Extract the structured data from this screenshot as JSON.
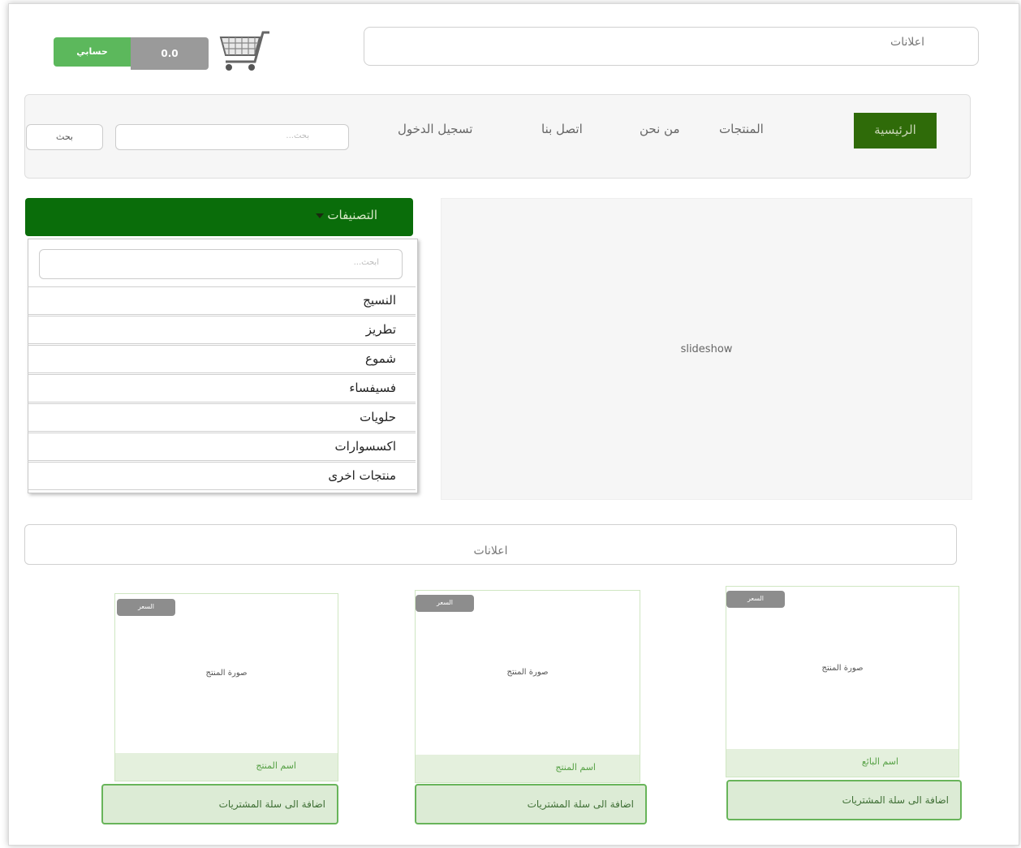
{
  "header": {
    "ads_label": "اعلانات",
    "account_button": "حسابي",
    "cart_balance": "0.0",
    "cart_icon": "shopping-cart-icon"
  },
  "nav": {
    "items": [
      "الرئيسية",
      "المنتجات",
      "من نحن",
      "اتصل بنا",
      "تسجيل الدخول"
    ],
    "active": "الرئيسية",
    "search_placeholder": "بحث...",
    "search_button": "بحث",
    "active_color": "#2f6b09"
  },
  "categories": {
    "title": "التصنيفات",
    "search_placeholder": "ابحث...",
    "items": [
      "النسيج",
      "تطريز",
      "شموع",
      "فسيفساء",
      "حلويات",
      "اكسسوارات",
      "منتجات اخرى"
    ],
    "header_color": "#0a6d0a"
  },
  "slideshow": {
    "label": "slideshow"
  },
  "ads_bar": {
    "label": "اعلانات"
  },
  "products": [
    {
      "price": "السعر",
      "image": "صورة المنتج",
      "name": "اسم البائع",
      "add_to_cart": "اضافة الى سلة المشتريات"
    },
    {
      "price": "السعر",
      "image": "صورة المنتج",
      "name": "اسم المنتج",
      "add_to_cart": "اضافة الى سلة المشتريات"
    },
    {
      "price": "السعر",
      "image": "صورة المنتج",
      "name": "اسم المنتج",
      "add_to_cart": "اضافة الى سلة المشتريات"
    }
  ],
  "colors": {
    "account": "#5cb85c",
    "balance": "#9a9a9a",
    "card_footer": "#e4f0dd"
  }
}
